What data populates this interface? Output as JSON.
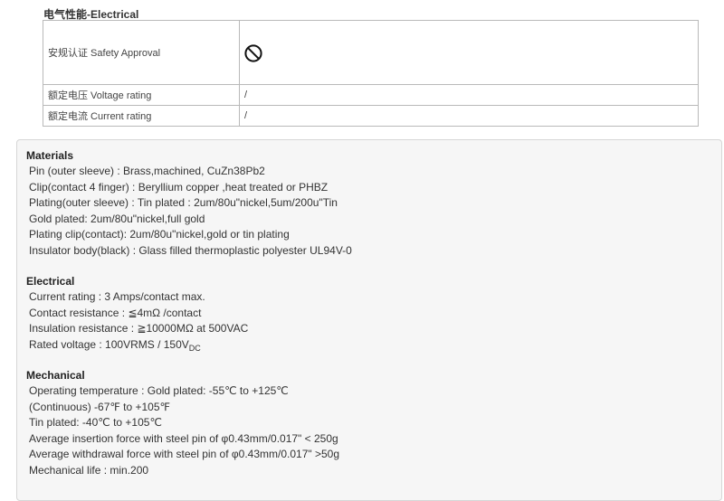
{
  "header": {
    "title": "电气性能-Electrical"
  },
  "spec_table": {
    "rows": [
      {
        "label": "安规认证 Safety Approval",
        "value": "",
        "icon": "prohibited-circle-icon"
      },
      {
        "label": "额定电压 Voltage rating",
        "value": "/"
      },
      {
        "label": "额定电流 Current rating",
        "value": "/"
      }
    ]
  },
  "details": {
    "materials": {
      "heading": "Materials",
      "lines": [
        "Pin (outer sleeve) : Brass,machined, CuZn38Pb2",
        "Clip(contact 4 finger) : Beryllium copper ,heat treated or PHBZ",
        "Plating(outer sleeve) : Tin plated : 2um/80u\"nickel,5um/200u\"Tin",
        "Gold plated: 2um/80u\"nickel,full gold",
        "Plating clip(contact): 2um/80u\"nickel,gold or tin plating",
        "Insulator body(black) : Glass filled thermoplastic polyester UL94V-0"
      ]
    },
    "electrical": {
      "heading": "Electrical",
      "lines": [
        "Current rating : 3 Amps/contact max.",
        "Contact resistance : ≦4mΩ /contact",
        "Insulation resistance : ≧10000MΩ at 500VAC"
      ],
      "rated_voltage": {
        "text": "Rated voltage : 100VRMS / 150V",
        "subscript": "DC"
      }
    },
    "mechanical": {
      "heading": "Mechanical",
      "lines": [
        "Operating temperature : Gold plated: -55℃ to +125℃",
        "(Continuous) -67℉ to +105℉",
        "Tin plated: -40℃ to +105℃",
        "Average insertion force with steel pin of φ0.43mm/0.017\" < 250g",
        "Average withdrawal force with steel pin of φ0.43mm/0.017\" >50g",
        "Mechanical life : min.200"
      ]
    }
  }
}
